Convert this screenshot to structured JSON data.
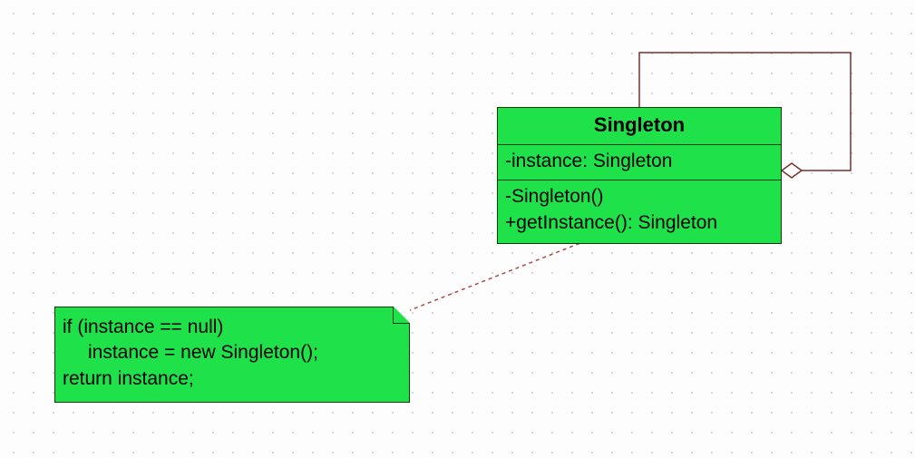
{
  "class": {
    "name": "Singleton",
    "attributes": [
      "-instance: Singleton"
    ],
    "operations": [
      "-Singleton()",
      "+getInstance(): Singleton"
    ]
  },
  "note": {
    "lines": [
      "if (instance == null)",
      "instance = new Singleton();",
      "return instance;"
    ]
  },
  "colors": {
    "fill": "#1fe24a",
    "border": "#003c00",
    "assoc": "#7a2e2e",
    "dash": "#a94a4a"
  }
}
